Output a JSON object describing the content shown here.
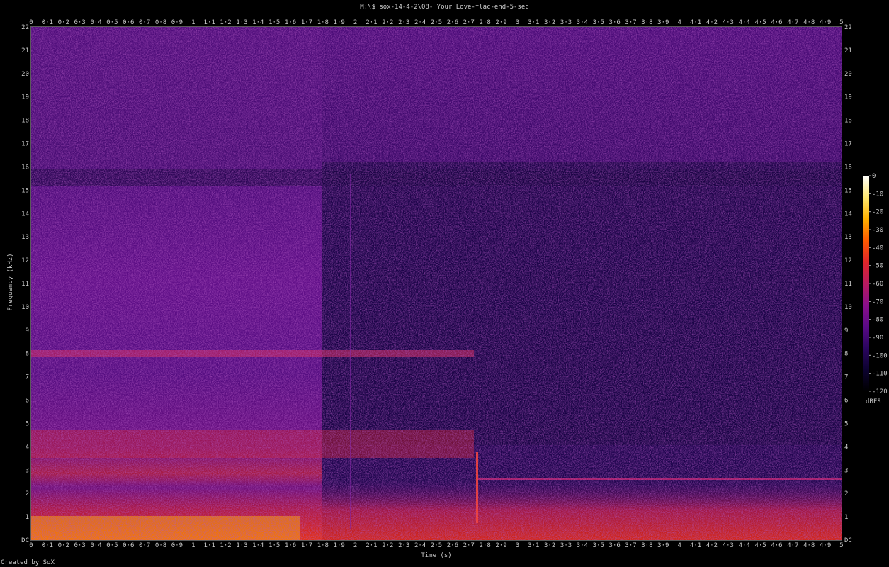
{
  "chart_data": {
    "type": "heatmap",
    "title": "M:\\$ sox-14-4-2\\08- Your Love-flac-end-5-sec",
    "xlabel": "Time (s)",
    "ylabel": "Frequency (kHz)",
    "xlim": [
      0,
      5
    ],
    "ylim": [
      0,
      22
    ],
    "x_ticks": [
      "0",
      "0·1",
      "0·2",
      "0·3",
      "0·4",
      "0·5",
      "0·6",
      "0·7",
      "0·8",
      "0·9",
      "1",
      "1·1",
      "1·2",
      "1·3",
      "1·4",
      "1·5",
      "1·6",
      "1·7",
      "1·8",
      "1·9",
      "2",
      "2·1",
      "2·2",
      "2·3",
      "2·4",
      "2·5",
      "2·6",
      "2·7",
      "2·8",
      "2·9",
      "3",
      "3·1",
      "3·2",
      "3·3",
      "3·4",
      "3·5",
      "3·6",
      "3·7",
      "3·8",
      "3·9",
      "4",
      "4·1",
      "4·2",
      "4·3",
      "4·4",
      "4·5",
      "4·6",
      "4·7",
      "4·8",
      "4·9",
      "5"
    ],
    "y_ticks": [
      "DC",
      "1",
      "2",
      "3",
      "4",
      "5",
      "6",
      "7",
      "8",
      "9",
      "10",
      "11",
      "12",
      "13",
      "14",
      "15",
      "16",
      "17",
      "18",
      "19",
      "20",
      "21",
      "22"
    ],
    "colorbar": {
      "unit": "dBFS",
      "range": [
        -120,
        0
      ],
      "ticks": [
        "0",
        "-10",
        "-20",
        "-30",
        "-40",
        "-50",
        "-60",
        "-70",
        "-80",
        "-90",
        "-100",
        "-110",
        "-120"
      ]
    },
    "colormap": [
      "#000000",
      "#0c0230",
      "#2a0560",
      "#5a0a86",
      "#8a0f8a",
      "#b81a5e",
      "#e0262a",
      "#ff5a00",
      "#ffb000",
      "#ffe870",
      "#ffffff"
    ],
    "note_features": {
      "high_freq_content_end_s": 1.8,
      "transient_time_s": 2.75,
      "tone_after_transient_khz": 2.7
    }
  },
  "credit": "Created by SoX"
}
